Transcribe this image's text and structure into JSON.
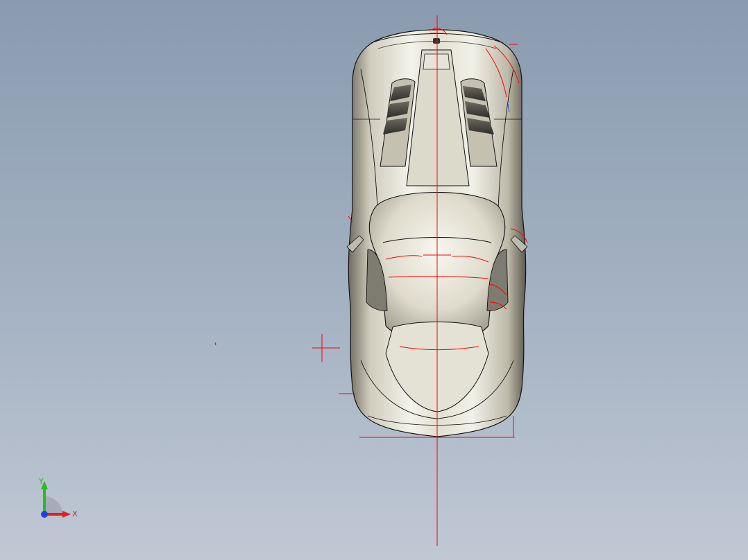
{
  "viewport": {
    "model": "sports-car-top-view",
    "background_top": "#8a9bb0",
    "background_bottom": "#c0c8d4",
    "body_color": "#d8d6c8",
    "sketch_color": "#ff0000"
  },
  "triad": {
    "x_label": "X",
    "y_label": "Y",
    "x_color": "#e02020",
    "y_color": "#20c020",
    "z_color": "#2040e0"
  }
}
